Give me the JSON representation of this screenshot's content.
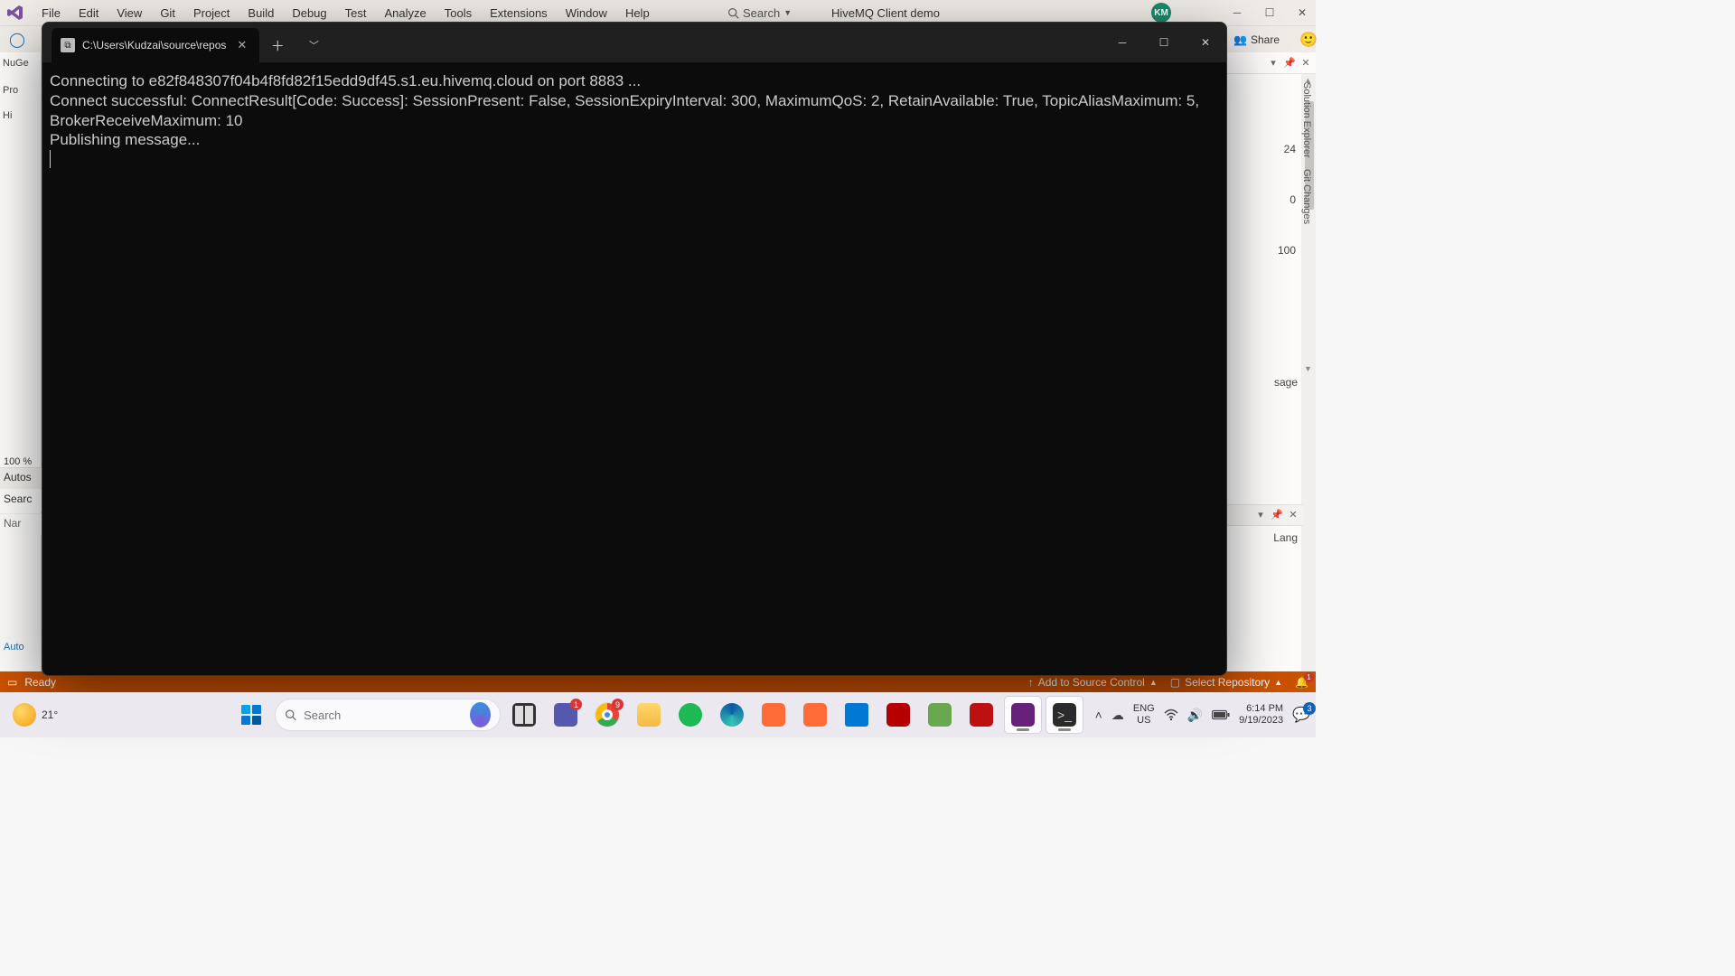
{
  "vs": {
    "menus": [
      "File",
      "Edit",
      "View",
      "Git",
      "Project",
      "Build",
      "Debug",
      "Test",
      "Analyze",
      "Tools",
      "Extensions",
      "Window",
      "Help"
    ],
    "search_label": "Search",
    "window_title": "HiveMQ Client demo",
    "user_initials": "KM",
    "share": "Share",
    "left_tabs": {
      "nuget": "NuGe",
      "pro": "Pro",
      "hi": "Hi"
    },
    "zoom": "100 %",
    "autos": "Autos",
    "search2": "Searc",
    "namecol": "Nar",
    "autos_link": "Auto",
    "right_nums": [
      "24",
      "0",
      "100"
    ],
    "sage_fragment": "sage",
    "lang_fragment": "Lang",
    "side_vertical": [
      "Solution Explorer",
      "Git Changes"
    ],
    "status": {
      "ready": "Ready",
      "add_source": "Add to Source Control",
      "select_repo": "Select Repository",
      "bell_count": "1"
    }
  },
  "terminal": {
    "tab_title": "C:\\Users\\Kudzai\\source\\repos",
    "output_lines": [
      "Connecting to e82f848307f04b4f8fd82f15edd9df45.s1.eu.hivemq.cloud on port 8883 ...",
      "Connect successful: ConnectResult[Code: Success]: SessionPresent: False, SessionExpiryInterval: 300, MaximumQoS: 2, RetainAvailable: True, TopicAliasMaximum: 5, BrokerReceiveMaximum: 10",
      "Publishing message..."
    ]
  },
  "taskbar": {
    "temp": "21°",
    "search_placeholder": "Search",
    "teams_badge": "1",
    "chrome_badge": "9",
    "lang": {
      "top": "ENG",
      "bottom": "US"
    },
    "clock": {
      "time": "6:14 PM",
      "date": "9/19/2023"
    },
    "notif_count": "3"
  }
}
